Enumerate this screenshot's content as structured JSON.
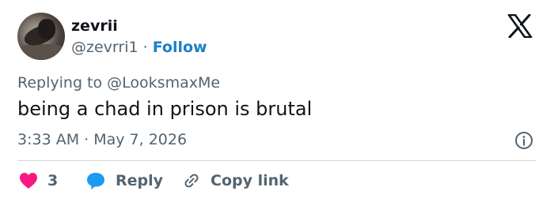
{
  "author": {
    "display_name": "zevrii",
    "handle": "@zevrri1",
    "separator": "·",
    "follow_label": "Follow"
  },
  "reply_context": {
    "prefix": "Replying to",
    "mention": "@LooksmaxMe"
  },
  "tweet": {
    "text": "being a chad in prison is brutal",
    "timestamp": "3:33 AM · May 7, 2026"
  },
  "actions": {
    "like_count": "3",
    "reply_label": "Reply",
    "copy_label": "Copy link"
  },
  "colors": {
    "text": "#0f1419",
    "secondary": "#536471",
    "link": "#1d7fc4",
    "like": "#f91880",
    "reply_icon": "#1d9bf0",
    "divider": "#cfd9de"
  },
  "icons": [
    "x-logo-icon",
    "info-icon",
    "heart-icon",
    "reply-bubble-icon",
    "link-icon"
  ]
}
